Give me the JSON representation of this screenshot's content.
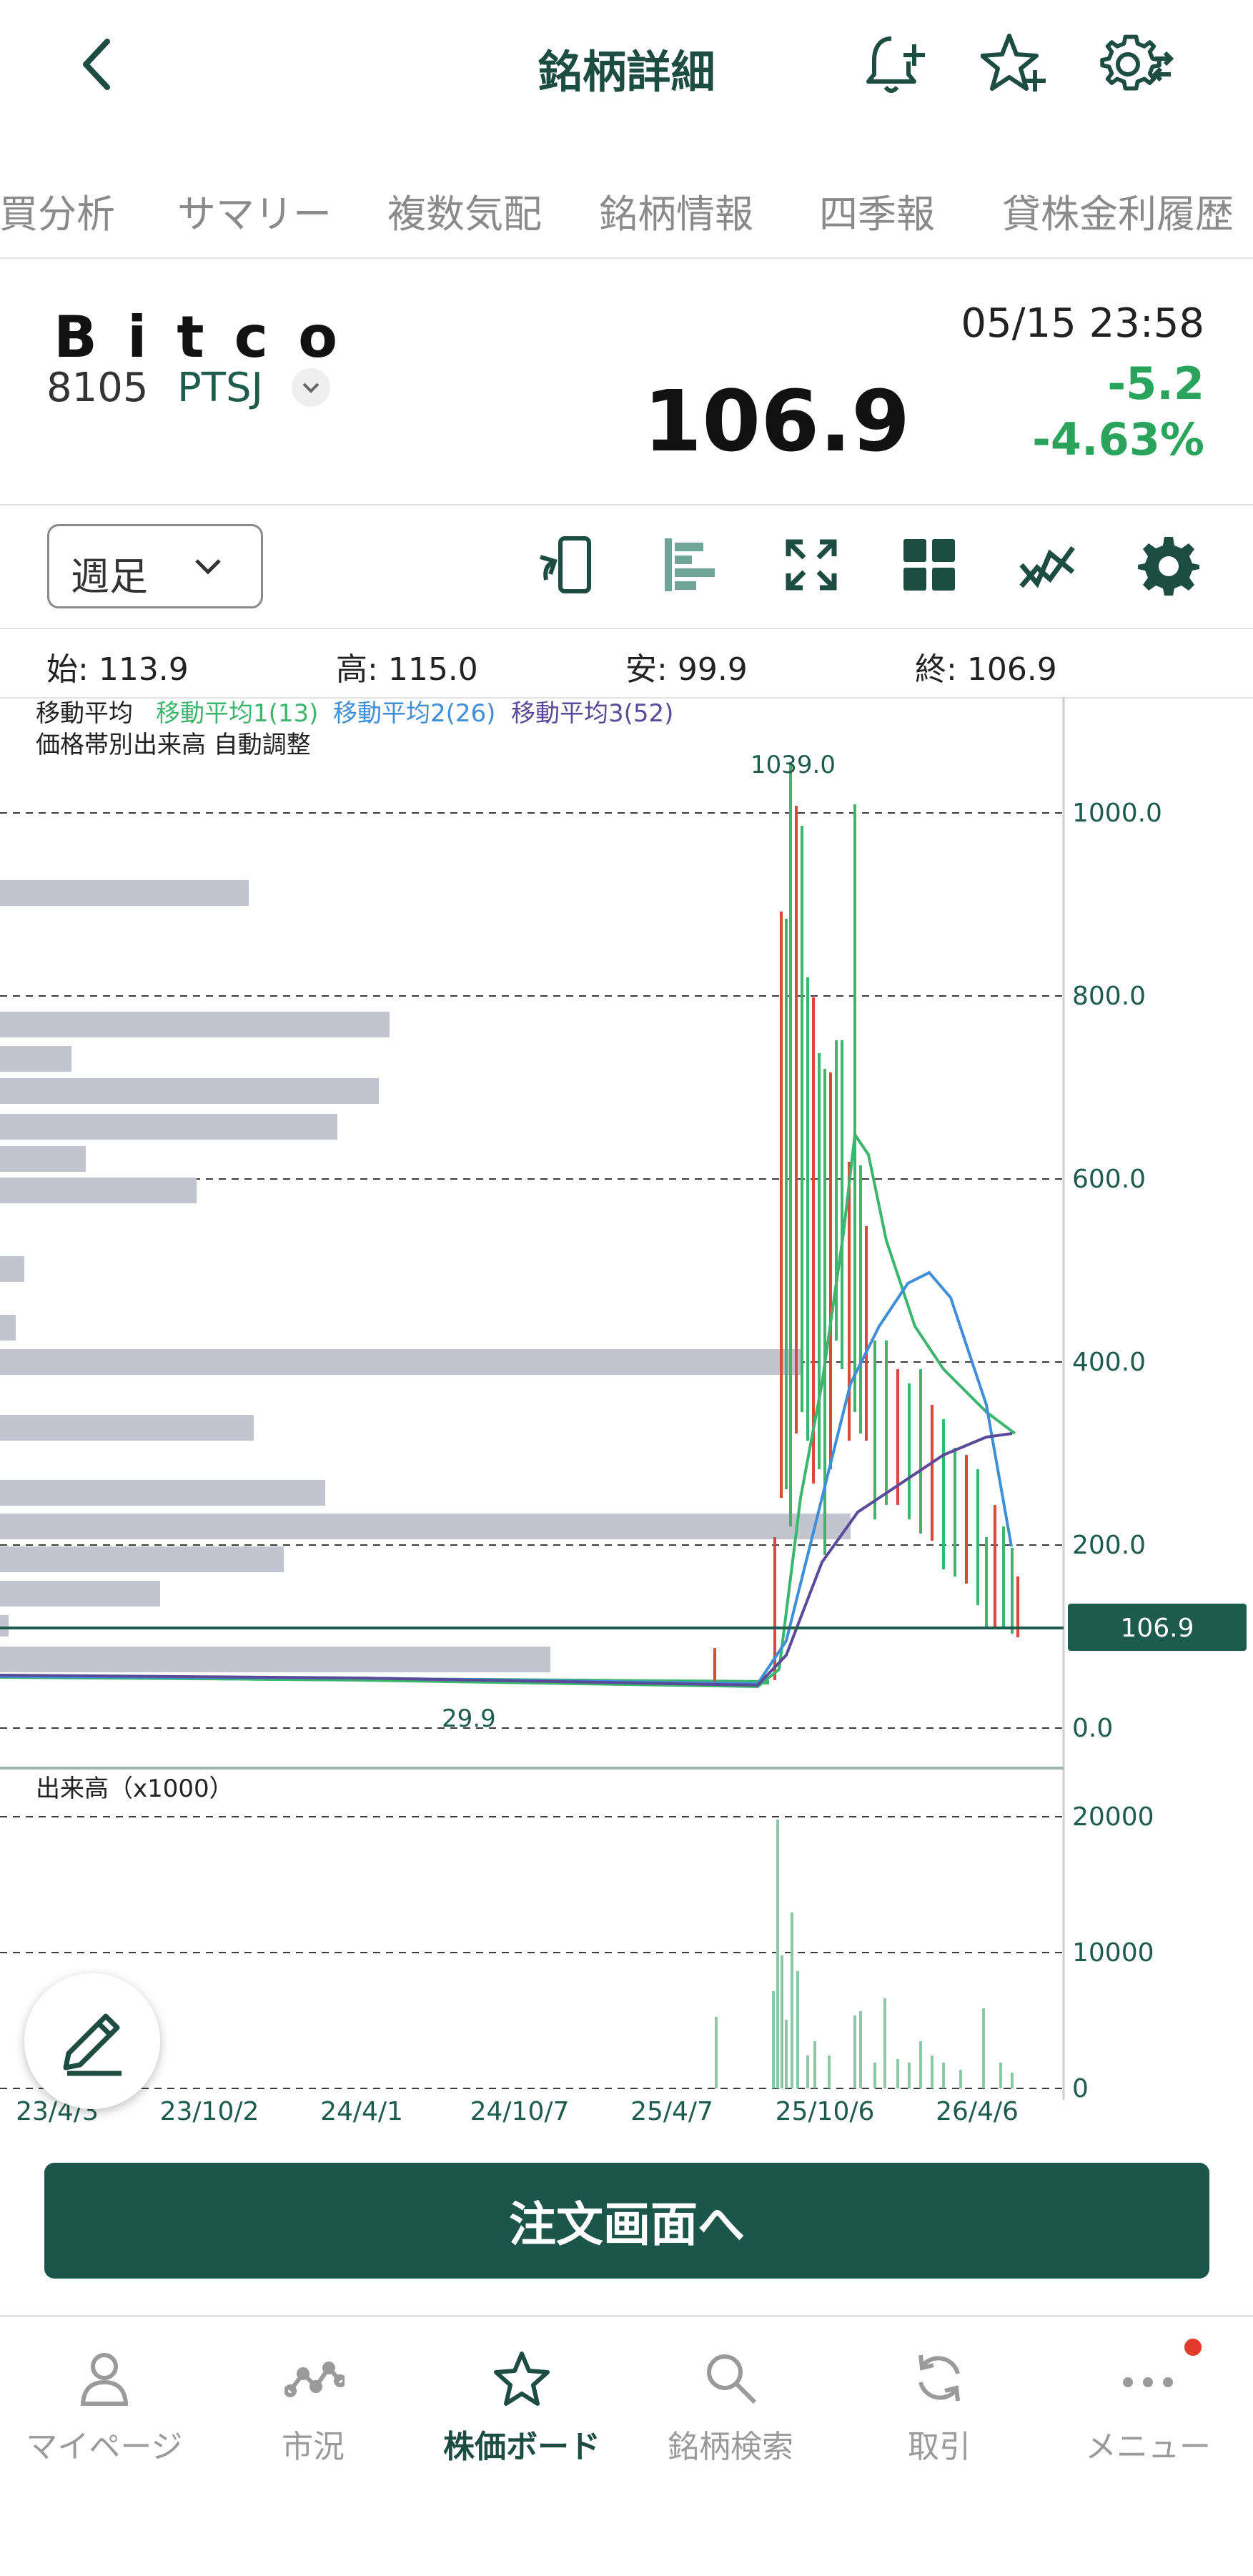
{
  "header": {
    "title": "銘柄詳細"
  },
  "tabs": [
    "売買分析",
    "サマリー",
    "複数気配",
    "銘柄情報",
    "四季報",
    "貸株金利履歴"
  ],
  "stock": {
    "name": "Bitco",
    "code": "8105",
    "market": "PTSJ",
    "price": "106.9",
    "datetime": "05/15 23:58",
    "change": "-5.2",
    "change_pct": "-4.63%",
    "colors": {
      "up": "#2aa45c",
      "accent": "#1d4d41"
    }
  },
  "period": {
    "selected": "週足"
  },
  "ohlc": {
    "open_label": "始:",
    "open": "113.9",
    "high_label": "高:",
    "high": "115.0",
    "low_label": "安:",
    "low": "99.9",
    "close_label": "終:",
    "close": "106.9"
  },
  "chart_data": {
    "type": "candlestick",
    "legend": {
      "prefix": "移動平均",
      "ma1": "移動平均1(13)",
      "ma2": "移動平均2(26)",
      "ma3": "移動平均3(52)",
      "line2": "価格帯別出来高 自動調整",
      "colors": {
        "ma1": "#3cb56e",
        "ma2": "#3f8fd8",
        "ma3": "#5a4a9a"
      }
    },
    "price_axis": {
      "ticks": [
        "1000.0",
        "800.0",
        "600.0",
        "400.0",
        "200.0",
        "0.0"
      ],
      "ylim": [
        0,
        1040
      ]
    },
    "current_price_label": "106.9",
    "max_label": "1039.0",
    "min_label": "29.9",
    "volume_title": "出来高（x1000）",
    "volume_axis": {
      "ticks": [
        "20000",
        "10000",
        "0"
      ]
    },
    "x_labels": [
      "23/4/3",
      "23/10/2",
      "24/4/1",
      "24/10/7",
      "25/4/7",
      "25/10/6",
      "26/4/6"
    ]
  },
  "order_button": {
    "label": "注文画面へ"
  },
  "nav": {
    "items": [
      {
        "label": "マイページ",
        "icon": "person-icon"
      },
      {
        "label": "市況",
        "icon": "market-line-icon"
      },
      {
        "label": "株価ボード",
        "icon": "star-icon",
        "active": true
      },
      {
        "label": "銘柄検索",
        "icon": "search-icon"
      },
      {
        "label": "取引",
        "icon": "refresh-icon"
      },
      {
        "label": "メニュー",
        "icon": "more-icon",
        "badge": true
      }
    ]
  }
}
